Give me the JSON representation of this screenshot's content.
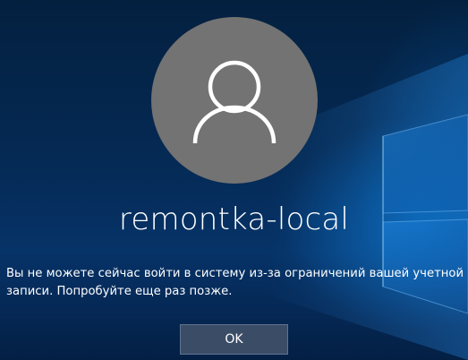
{
  "account": {
    "username": "remontka-local",
    "avatar_icon": "user-icon"
  },
  "message": {
    "text": "Вы не можете сейчас войти в систему из-за ограничений вашей учетной записи. Попробуйте еще раз позже."
  },
  "actions": {
    "ok_label": "OK"
  },
  "colors": {
    "background": "#052a55",
    "avatar_background": "#737373",
    "button_background": "#3b4d66",
    "text": "#ffffff"
  }
}
